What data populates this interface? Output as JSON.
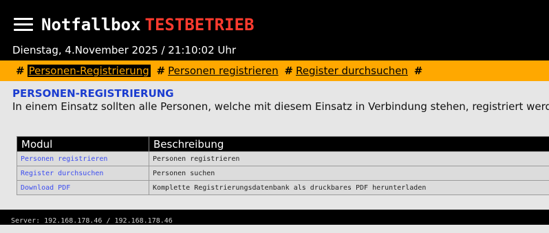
{
  "header": {
    "menu_icon": "hamburger-menu-icon",
    "app_name": "Notfallbox",
    "mode_label": "TESTBETRIEB",
    "datetime": "Dienstag, 4.November 2025 / 21:10:02 Uhr"
  },
  "nav": {
    "separator": "#",
    "items": [
      {
        "label": "Personen-Registrierung",
        "active": true
      },
      {
        "label": "Personen registrieren",
        "active": false
      },
      {
        "label": "Register durchsuchen",
        "active": false
      }
    ]
  },
  "section": {
    "title": "PERSONEN-REGISTRIERUNG",
    "text": "In einem Einsatz sollten alle Personen, welche mit diesem Einsatz in Verbindung stehen, registriert werden."
  },
  "table": {
    "headers": [
      "Modul",
      "Beschreibung"
    ],
    "rows": [
      {
        "module": "Personen registrieren",
        "description": "Personen registrieren"
      },
      {
        "module": "Register durchsuchen",
        "description": "Personen suchen"
      },
      {
        "module": "Download PDF",
        "description": "Komplette Registrierungsdatenbank als druckbares PDF herunterladen"
      }
    ]
  },
  "footer": {
    "server_text": "Server: 192.168.178.46 / 192.168.178.46"
  },
  "colors": {
    "header_bg": "#000000",
    "mode_red": "#ff3b2f",
    "nav_bg": "#ffa800",
    "section_title": "#1a3cd0",
    "link_blue": "#3b4cf0",
    "page_bg": "#e6e6e6"
  }
}
